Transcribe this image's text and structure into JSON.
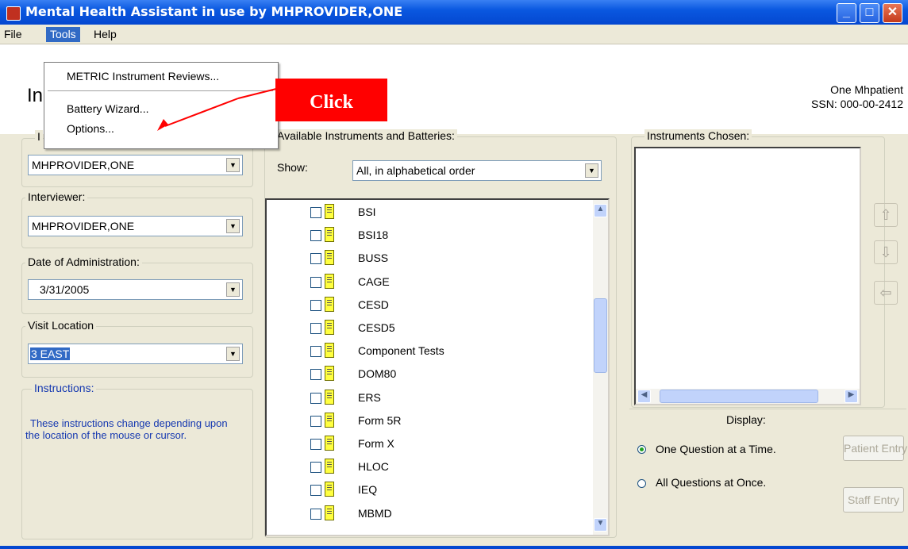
{
  "window": {
    "title": "Mental Health Assistant in use by MHPROVIDER,ONE",
    "minimize_icon": "minimize-icon",
    "maximize_icon": "maximize-icon",
    "close_icon": "close-icon"
  },
  "menubar": {
    "items": [
      {
        "label": "File"
      },
      {
        "label": "Tools"
      },
      {
        "label": "Help"
      }
    ]
  },
  "tools_menu": {
    "items": [
      {
        "label": "METRIC Instrument Reviews..."
      },
      {
        "label": "Battery Wizard..."
      },
      {
        "label": "Options..."
      }
    ]
  },
  "annotation": {
    "label": "Click",
    "color": "#ff0000"
  },
  "header": {
    "title_fragment": "In",
    "patient_name": "One Mhpatient",
    "patient_ssn": "SSN: 000-00-2412"
  },
  "left": {
    "group1": {
      "label": "I",
      "value": "MHPROVIDER,ONE"
    },
    "interviewer": {
      "label": "Interviewer:",
      "value": "MHPROVIDER,ONE"
    },
    "date": {
      "label": "Date of Administration:",
      "value": "3/31/2005"
    },
    "location": {
      "label": "Visit Location",
      "value": "3 EAST"
    },
    "instructions": {
      "label": "Instructions:",
      "text": "These instructions change depending upon the location of the mouse or cursor."
    }
  },
  "available": {
    "label": "Available Instruments and Batteries:",
    "show_label": "Show:",
    "show_value": "All, in alphabetical order",
    "items": [
      "BSI",
      "BSI18",
      "BUSS",
      "CAGE",
      "CESD",
      "CESD5",
      "Component Tests",
      "DOM80",
      "ERS",
      "Form 5R",
      "Form X",
      "HLOC",
      "IEQ",
      "MBMD"
    ]
  },
  "chosen": {
    "label": "Instruments Chosen:"
  },
  "display": {
    "label": "Display:",
    "options": [
      {
        "label": "One Question at a Time.",
        "selected": true
      },
      {
        "label": "All Questions at Once.",
        "selected": false
      }
    ],
    "patient_entry": "Patient Entry",
    "staff_entry": "Staff Entry"
  },
  "colors": {
    "titlebar": "#0a58e0",
    "menu_highlight": "#316ac5",
    "instructions_text": "#1538b0"
  }
}
